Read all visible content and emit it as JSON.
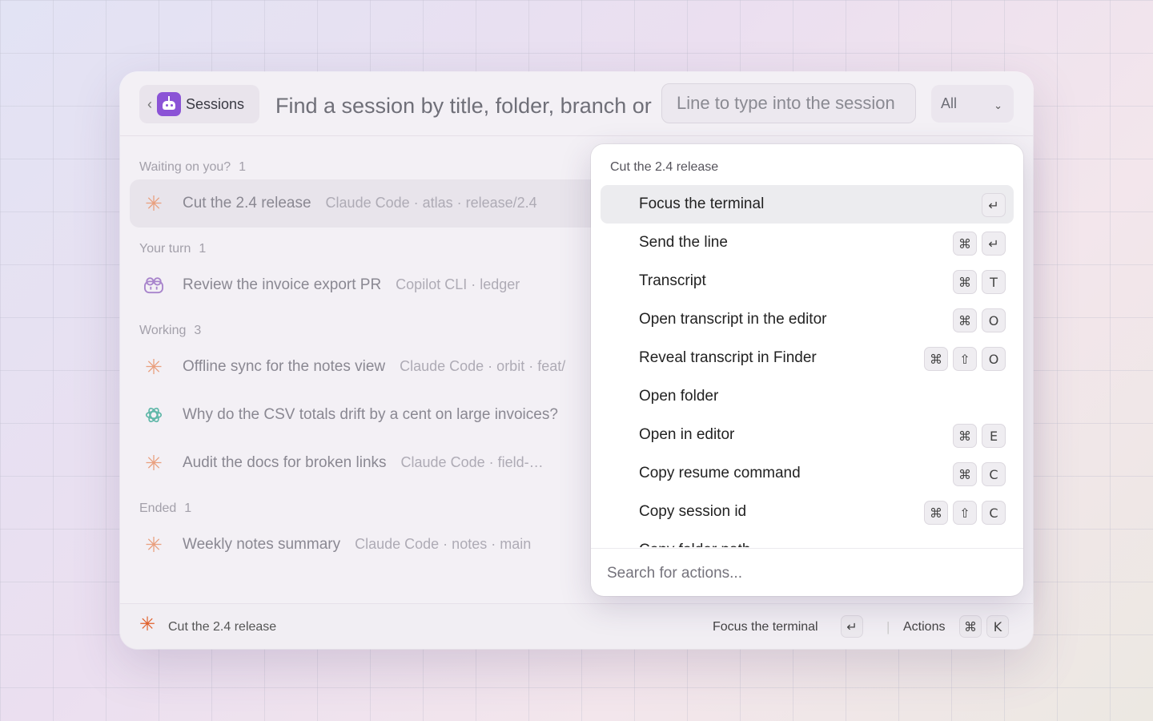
{
  "header": {
    "back_label": "‹",
    "sessions_label": "Sessions",
    "search_placeholder": "Find a session by title, folder, branch or",
    "line_placeholder": "Line to type into the session",
    "filter_value": "All",
    "filter_caret": "⌄"
  },
  "groups": [
    {
      "label": "Waiting on you?",
      "count": "1"
    },
    {
      "label": "Your turn",
      "count": "1"
    },
    {
      "label": "Working",
      "count": "3"
    },
    {
      "label": "Ended",
      "count": "1"
    }
  ],
  "sessions": [
    {
      "title": "Cut the 2.4 release",
      "meta": "Claude Code · atlas · release/2.4",
      "icon": "claude-icon"
    },
    {
      "title": "Review the invoice export PR",
      "meta": "Copilot CLI · ledger",
      "icon": "copilot-icon"
    },
    {
      "title": "Offline sync for the notes view",
      "meta": "Claude Code · orbit · feat/",
      "icon": "claude-icon"
    },
    {
      "title": "Why do the CSV totals drift by a cent on large invoices?",
      "meta": "",
      "icon": "openai-icon"
    },
    {
      "title": "Audit the docs for broken links",
      "meta": "Claude Code · field-…",
      "icon": "claude-icon"
    },
    {
      "title": "Weekly notes summary",
      "meta": "Claude Code · notes · main",
      "icon": "claude-icon"
    }
  ],
  "popover": {
    "title": "Cut the 2.4 release",
    "actions": [
      {
        "label": "Focus the terminal",
        "keys": [
          "↵"
        ]
      },
      {
        "label": "Send the line",
        "keys": [
          "⌘",
          "↵"
        ]
      },
      {
        "label": "Transcript",
        "keys": [
          "⌘",
          "T"
        ]
      },
      {
        "label": "Open transcript in the editor",
        "keys": [
          "⌘",
          "O"
        ]
      },
      {
        "label": "Reveal transcript in Finder",
        "keys": [
          "⌘",
          "⇧",
          "O"
        ]
      },
      {
        "label": "Open folder",
        "keys": []
      },
      {
        "label": "Open in editor",
        "keys": [
          "⌘",
          "E"
        ]
      },
      {
        "label": "Copy resume command",
        "keys": [
          "⌘",
          "C"
        ]
      },
      {
        "label": "Copy session id",
        "keys": [
          "⌘",
          "⇧",
          "C"
        ]
      },
      {
        "label": "Copy folder path",
        "keys": []
      }
    ],
    "search_placeholder": "Search for actions..."
  },
  "footer": {
    "session_title": "Cut the 2.4 release",
    "primary_action": "Focus the terminal",
    "primary_key": "↵",
    "actions_label": "Actions",
    "actions_keys": [
      "⌘",
      "K"
    ]
  },
  "colors": {
    "accent": "#8b53d6",
    "claude": "#e9a07f",
    "claude_active": "#e0602a",
    "copilot": "#a884cc",
    "openai": "#5fb7a8"
  }
}
